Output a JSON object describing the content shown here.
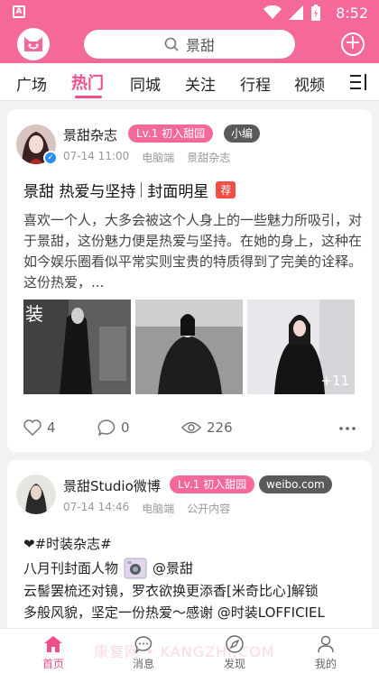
{
  "status_bar": {
    "app_icon_letter": "A",
    "time": "8:52"
  },
  "app_bar": {
    "search_text": "景甜"
  },
  "tabs": [
    "广场",
    "热门",
    "同城",
    "关注",
    "行程",
    "视频"
  ],
  "active_tab": "热门",
  "posts": [
    {
      "author": "景甜杂志",
      "level_badge": "Lv.1 初入甜园",
      "role_badge": "小编",
      "time": "07-14 11:00",
      "device": "电脑端",
      "source": "景甜杂志",
      "title_part1": "景甜 热爱与坚持",
      "title_part2": "封面明星",
      "title_tag": "荐",
      "body": "喜欢一个人，大多会被这个人身上的一些魅力所吸引，对于景甜，这份魅力便是热爱与坚持。在她的身上，这种在如今娱乐圈看似平常实则宝贵的特质得到了完美的诠释。这份热爱，...",
      "image_overlay_text": "装",
      "extra_images": "+11",
      "likes": "4",
      "comments": "0",
      "views": "226"
    },
    {
      "author": "景甜Studio微博",
      "level_badge": "Lv.1 初入甜园",
      "role_badge": "weibo.com",
      "time": "07-14 14:46",
      "device": "电脑端",
      "source": "公开内容",
      "line1": "❤#时装杂志#",
      "line2_prefix": "八月刊封面人物",
      "line2_suffix": "@景甜",
      "line3": "云髻罢梳还对镜，罗衣欲换更添香[米奇比心]解锁",
      "line4": "多般风貌，坚定一份热爱～感谢 @时装LOFFICIEL"
    }
  ],
  "bottom_nav": [
    "首页",
    "消息",
    "发现",
    "我的"
  ],
  "watermark": "康复网 • KANGZHI.COM",
  "colors": {
    "brand_pink": "#f4699a",
    "active_pink": "#ef4f8a",
    "recommend_red": "#f04d44"
  }
}
